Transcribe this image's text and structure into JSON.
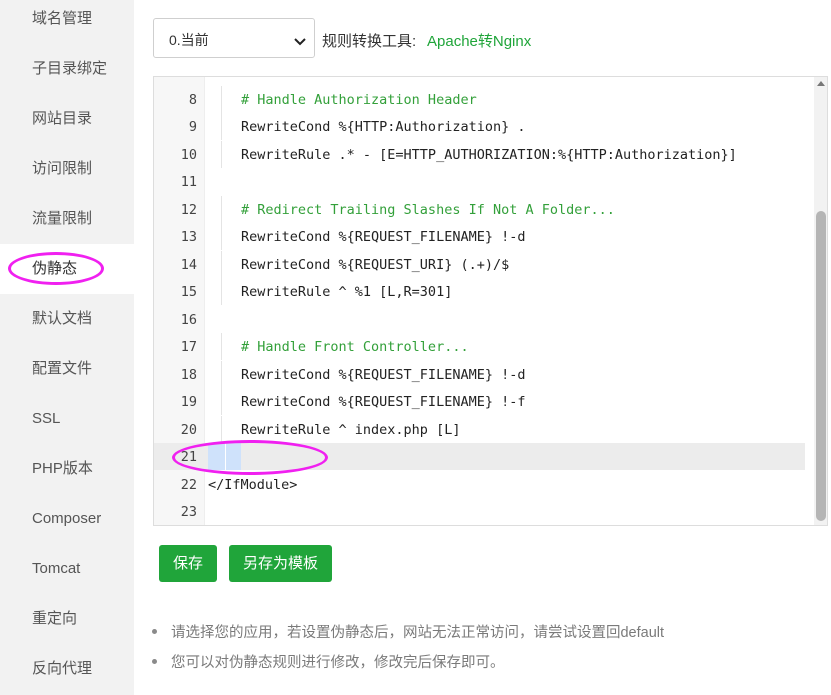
{
  "sidebar": {
    "items": [
      {
        "label": "域名管理"
      },
      {
        "label": "子目录绑定"
      },
      {
        "label": "网站目录"
      },
      {
        "label": "访问限制"
      },
      {
        "label": "流量限制"
      },
      {
        "label": "伪静态",
        "active": true
      },
      {
        "label": "默认文档"
      },
      {
        "label": "配置文件"
      },
      {
        "label": "SSL"
      },
      {
        "label": "PHP版本"
      },
      {
        "label": "Composer"
      },
      {
        "label": "Tomcat"
      },
      {
        "label": "重定向"
      },
      {
        "label": "反向代理"
      }
    ]
  },
  "toolbar": {
    "select_value": "0.当前",
    "tool_label": "规则转换工具:",
    "tool_link": "Apache转Nginx"
  },
  "editor": {
    "lines": [
      {
        "num": "8",
        "text": "# Handle Authorization Header"
      },
      {
        "num": "9",
        "text": "RewriteCond %{HTTP:Authorization} ."
      },
      {
        "num": "10",
        "text": "RewriteRule .* - [E=HTTP_AUTHORIZATION:%{HTTP:Authorization}]"
      },
      {
        "num": "11",
        "text": ""
      },
      {
        "num": "12",
        "text": "# Redirect Trailing Slashes If Not A Folder..."
      },
      {
        "num": "13",
        "text": "RewriteCond %{REQUEST_FILENAME} !-d"
      },
      {
        "num": "14",
        "text": "RewriteCond %{REQUEST_URI} (.+)/$"
      },
      {
        "num": "15",
        "text": "RewriteRule ^ %1 [L,R=301]"
      },
      {
        "num": "16",
        "text": ""
      },
      {
        "num": "17",
        "text": "# Handle Front Controller..."
      },
      {
        "num": "18",
        "text": "RewriteCond %{REQUEST_FILENAME} !-d"
      },
      {
        "num": "19",
        "text": "RewriteCond %{REQUEST_FILENAME} !-f"
      },
      {
        "num": "20",
        "text": "RewriteRule ^ index.php [L]"
      },
      {
        "num": "21",
        "text": ""
      },
      {
        "num": "22",
        "text": "</IfModule>"
      },
      {
        "num": "23",
        "text": ""
      }
    ]
  },
  "buttons": {
    "save": "保存",
    "save_as_template": "另存为模板"
  },
  "notes": [
    "请选择您的应用，若设置伪静态后，网站无法正常访问，请尝试设置回default",
    "您可以对伪静态规则进行修改，修改完后保存即可。"
  ],
  "colors": {
    "accent": "#20a53a",
    "highlight_ring": "#f020f0"
  }
}
